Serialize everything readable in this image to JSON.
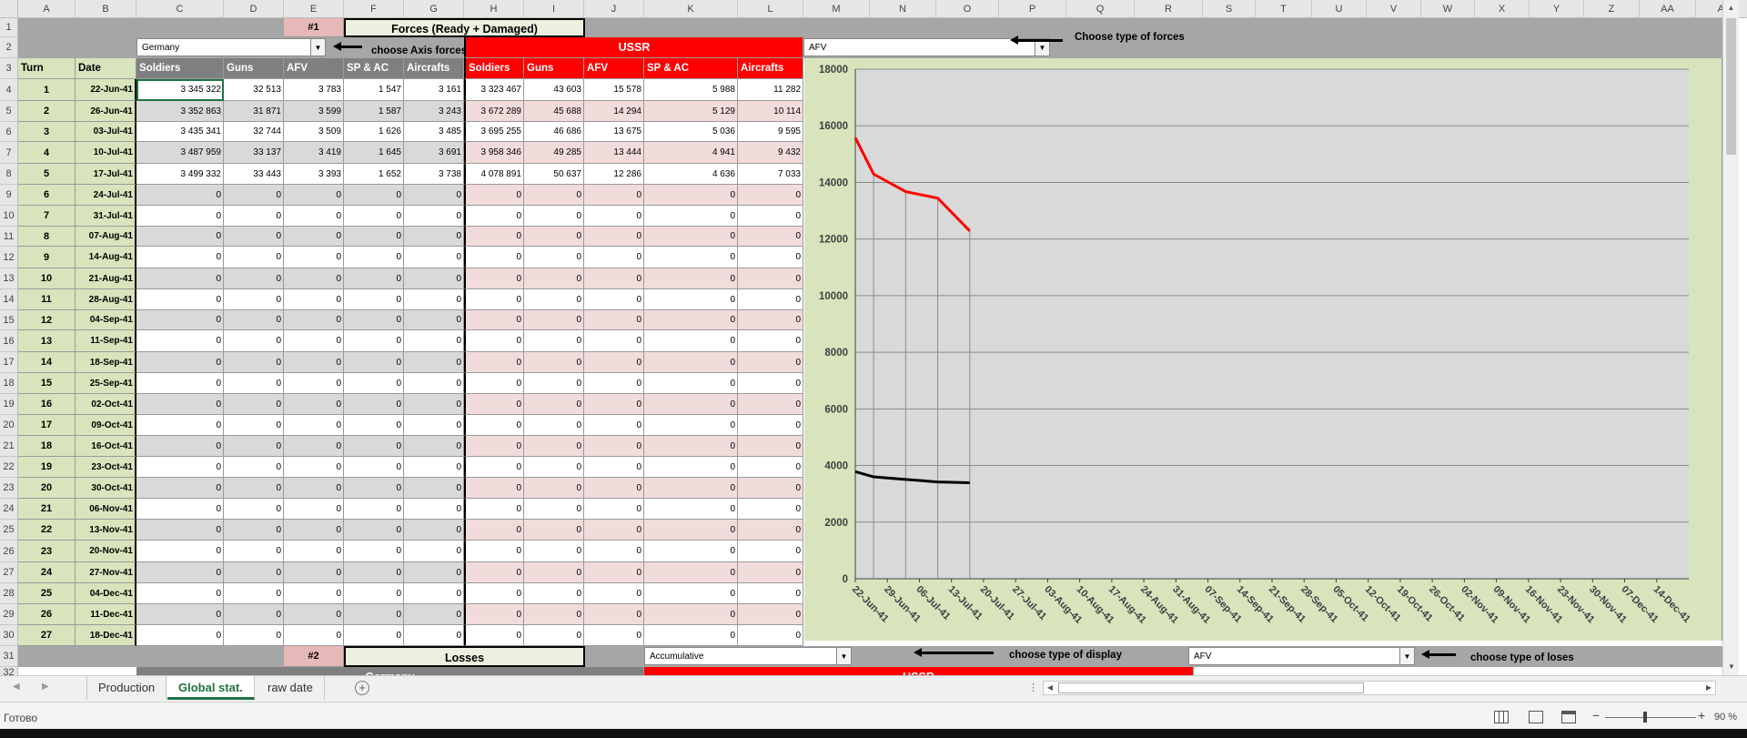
{
  "columns": [
    "A",
    "B",
    "C",
    "D",
    "E",
    "F",
    "G",
    "H",
    "I",
    "J",
    "K",
    "L",
    "M",
    "N",
    "O",
    "P",
    "Q",
    "R",
    "S",
    "T",
    "U",
    "V",
    "W",
    "X",
    "Y",
    "Z",
    "AA",
    "AB"
  ],
  "rows": [
    "1",
    "2",
    "3",
    "4",
    "5",
    "6",
    "7",
    "8",
    "9",
    "10",
    "11",
    "12",
    "13",
    "14",
    "15",
    "16",
    "17",
    "18",
    "19",
    "20",
    "21",
    "22",
    "23",
    "24",
    "25",
    "26",
    "27",
    "28",
    "29",
    "30",
    "31",
    "32"
  ],
  "section1": {
    "badge": "#1",
    "title": "Forces (Ready + Damaged)"
  },
  "axis_dropdown": {
    "value": "Germany",
    "label": "choose Axis forces"
  },
  "ussr_header": "USSR",
  "forces_dropdown": {
    "value": "AFV",
    "label": "Choose type of forces"
  },
  "table": {
    "headers": [
      "Turn",
      "Date",
      "Soldiers",
      "Guns",
      "AFV",
      "SP & AC",
      "Aircrafts",
      "Soldiers",
      "Guns",
      "AFV",
      "SP & AC",
      "Aircrafts"
    ],
    "rows": [
      {
        "turn": "1",
        "date": "22-Jun-41",
        "values": [
          "3 345 322",
          "32 513",
          "3 783",
          "1 547",
          "3 161",
          "3 323 467",
          "43 603",
          "15 578",
          "5 988",
          "11 282"
        ]
      },
      {
        "turn": "2",
        "date": "26-Jun-41",
        "values": [
          "3 352 863",
          "31 871",
          "3 599",
          "1 587",
          "3 243",
          "3 672 289",
          "45 688",
          "14 294",
          "5 129",
          "10 114"
        ]
      },
      {
        "turn": "3",
        "date": "03-Jul-41",
        "values": [
          "3 435 341",
          "32 744",
          "3 509",
          "1 626",
          "3 485",
          "3 695 255",
          "46 686",
          "13 675",
          "5 036",
          "9 595"
        ]
      },
      {
        "turn": "4",
        "date": "10-Jul-41",
        "values": [
          "3 487 959",
          "33 137",
          "3 419",
          "1 645",
          "3 691",
          "3 958 346",
          "49 285",
          "13 444",
          "4 941",
          "9 432"
        ]
      },
      {
        "turn": "5",
        "date": "17-Jul-41",
        "values": [
          "3 499 332",
          "33 443",
          "3 393",
          "1 652",
          "3 738",
          "4 078 891",
          "50 637",
          "12 286",
          "4 636",
          "7 033"
        ]
      },
      {
        "turn": "6",
        "date": "24-Jul-41",
        "values": [
          "0",
          "0",
          "0",
          "0",
          "0",
          "0",
          "0",
          "0",
          "0",
          "0"
        ]
      },
      {
        "turn": "7",
        "date": "31-Jul-41",
        "values": [
          "0",
          "0",
          "0",
          "0",
          "0",
          "0",
          "0",
          "0",
          "0",
          "0"
        ]
      },
      {
        "turn": "8",
        "date": "07-Aug-41",
        "values": [
          "0",
          "0",
          "0",
          "0",
          "0",
          "0",
          "0",
          "0",
          "0",
          "0"
        ]
      },
      {
        "turn": "9",
        "date": "14-Aug-41",
        "values": [
          "0",
          "0",
          "0",
          "0",
          "0",
          "0",
          "0",
          "0",
          "0",
          "0"
        ]
      },
      {
        "turn": "10",
        "date": "21-Aug-41",
        "values": [
          "0",
          "0",
          "0",
          "0",
          "0",
          "0",
          "0",
          "0",
          "0",
          "0"
        ]
      },
      {
        "turn": "11",
        "date": "28-Aug-41",
        "values": [
          "0",
          "0",
          "0",
          "0",
          "0",
          "0",
          "0",
          "0",
          "0",
          "0"
        ]
      },
      {
        "turn": "12",
        "date": "04-Sep-41",
        "values": [
          "0",
          "0",
          "0",
          "0",
          "0",
          "0",
          "0",
          "0",
          "0",
          "0"
        ]
      },
      {
        "turn": "13",
        "date": "11-Sep-41",
        "values": [
          "0",
          "0",
          "0",
          "0",
          "0",
          "0",
          "0",
          "0",
          "0",
          "0"
        ]
      },
      {
        "turn": "14",
        "date": "18-Sep-41",
        "values": [
          "0",
          "0",
          "0",
          "0",
          "0",
          "0",
          "0",
          "0",
          "0",
          "0"
        ]
      },
      {
        "turn": "15",
        "date": "25-Sep-41",
        "values": [
          "0",
          "0",
          "0",
          "0",
          "0",
          "0",
          "0",
          "0",
          "0",
          "0"
        ]
      },
      {
        "turn": "16",
        "date": "02-Oct-41",
        "values": [
          "0",
          "0",
          "0",
          "0",
          "0",
          "0",
          "0",
          "0",
          "0",
          "0"
        ]
      },
      {
        "turn": "17",
        "date": "09-Oct-41",
        "values": [
          "0",
          "0",
          "0",
          "0",
          "0",
          "0",
          "0",
          "0",
          "0",
          "0"
        ]
      },
      {
        "turn": "18",
        "date": "16-Oct-41",
        "values": [
          "0",
          "0",
          "0",
          "0",
          "0",
          "0",
          "0",
          "0",
          "0",
          "0"
        ]
      },
      {
        "turn": "19",
        "date": "23-Oct-41",
        "values": [
          "0",
          "0",
          "0",
          "0",
          "0",
          "0",
          "0",
          "0",
          "0",
          "0"
        ]
      },
      {
        "turn": "20",
        "date": "30-Oct-41",
        "values": [
          "0",
          "0",
          "0",
          "0",
          "0",
          "0",
          "0",
          "0",
          "0",
          "0"
        ]
      },
      {
        "turn": "21",
        "date": "06-Nov-41",
        "values": [
          "0",
          "0",
          "0",
          "0",
          "0",
          "0",
          "0",
          "0",
          "0",
          "0"
        ]
      },
      {
        "turn": "22",
        "date": "13-Nov-41",
        "values": [
          "0",
          "0",
          "0",
          "0",
          "0",
          "0",
          "0",
          "0",
          "0",
          "0"
        ]
      },
      {
        "turn": "23",
        "date": "20-Nov-41",
        "values": [
          "0",
          "0",
          "0",
          "0",
          "0",
          "0",
          "0",
          "0",
          "0",
          "0"
        ]
      },
      {
        "turn": "24",
        "date": "27-Nov-41",
        "values": [
          "0",
          "0",
          "0",
          "0",
          "0",
          "0",
          "0",
          "0",
          "0",
          "0"
        ]
      },
      {
        "turn": "25",
        "date": "04-Dec-41",
        "values": [
          "0",
          "0",
          "0",
          "0",
          "0",
          "0",
          "0",
          "0",
          "0",
          "0"
        ]
      },
      {
        "turn": "26",
        "date": "11-Dec-41",
        "values": [
          "0",
          "0",
          "0",
          "0",
          "0",
          "0",
          "0",
          "0",
          "0",
          "0"
        ]
      },
      {
        "turn": "27",
        "date": "18-Dec-41",
        "values": [
          "0",
          "0",
          "0",
          "0",
          "0",
          "0",
          "0",
          "0",
          "0",
          "0"
        ]
      }
    ]
  },
  "section2": {
    "badge": "#2",
    "title": "Losses"
  },
  "display_dropdown": {
    "value": "Accumulative",
    "label": "choose type of display"
  },
  "loses_dropdown": {
    "value": "AFV",
    "label": "choose type of loses"
  },
  "row32": {
    "germany": "Germany",
    "ussr": "USSR"
  },
  "tabs": [
    "Production",
    "Global stat.",
    "raw date"
  ],
  "status": {
    "ready": "Готово",
    "zoom": "90 %"
  },
  "colors": {
    "germany_line": "#000000",
    "ussr_line": "#ff0000",
    "ussr_header": "#ff0000",
    "ussr_row_alt": "#f2dcdb",
    "turn_fill": "#d8e4bc",
    "plot_bg": "#d9d9d9",
    "chart_frame": "#d8e4bc",
    "active_tab": "#217346"
  },
  "chart_data": {
    "type": "line",
    "categories": [
      "22-Jun-41",
      "29-Jun-41",
      "06-Jul-41",
      "13-Jul-41",
      "20-Jul-41",
      "27-Jul-41",
      "03-Aug-41",
      "10-Aug-41",
      "17-Aug-41",
      "24-Aug-41",
      "31-Aug-41",
      "07-Sep-41",
      "14-Sep-41",
      "21-Sep-41",
      "28-Sep-41",
      "05-Oct-41",
      "12-Oct-41",
      "19-Oct-41",
      "26-Oct-41",
      "02-Nov-41",
      "09-Nov-41",
      "16-Nov-41",
      "23-Nov-41",
      "30-Nov-41",
      "07-Dec-41",
      "14-Dec-41"
    ],
    "series": [
      {
        "x": [
          "22-Jun-41",
          "26-Jun-41",
          "03-Jul-41",
          "10-Jul-41",
          "17-Jul-41"
        ],
        "values": [
          15578,
          14294,
          13675,
          13444,
          12286
        ],
        "color": "#ff0000"
      },
      {
        "x": [
          "22-Jun-41",
          "26-Jun-41",
          "03-Jul-41",
          "10-Jul-41",
          "17-Jul-41"
        ],
        "values": [
          3783,
          3599,
          3509,
          3419,
          3393
        ],
        "color": "#000000"
      }
    ],
    "yticks": [
      "0",
      "2000",
      "4000",
      "6000",
      "8000",
      "10000",
      "12000",
      "14000",
      "16000",
      "18000"
    ],
    "ylim": [
      0,
      18000
    ],
    "grid": true
  }
}
